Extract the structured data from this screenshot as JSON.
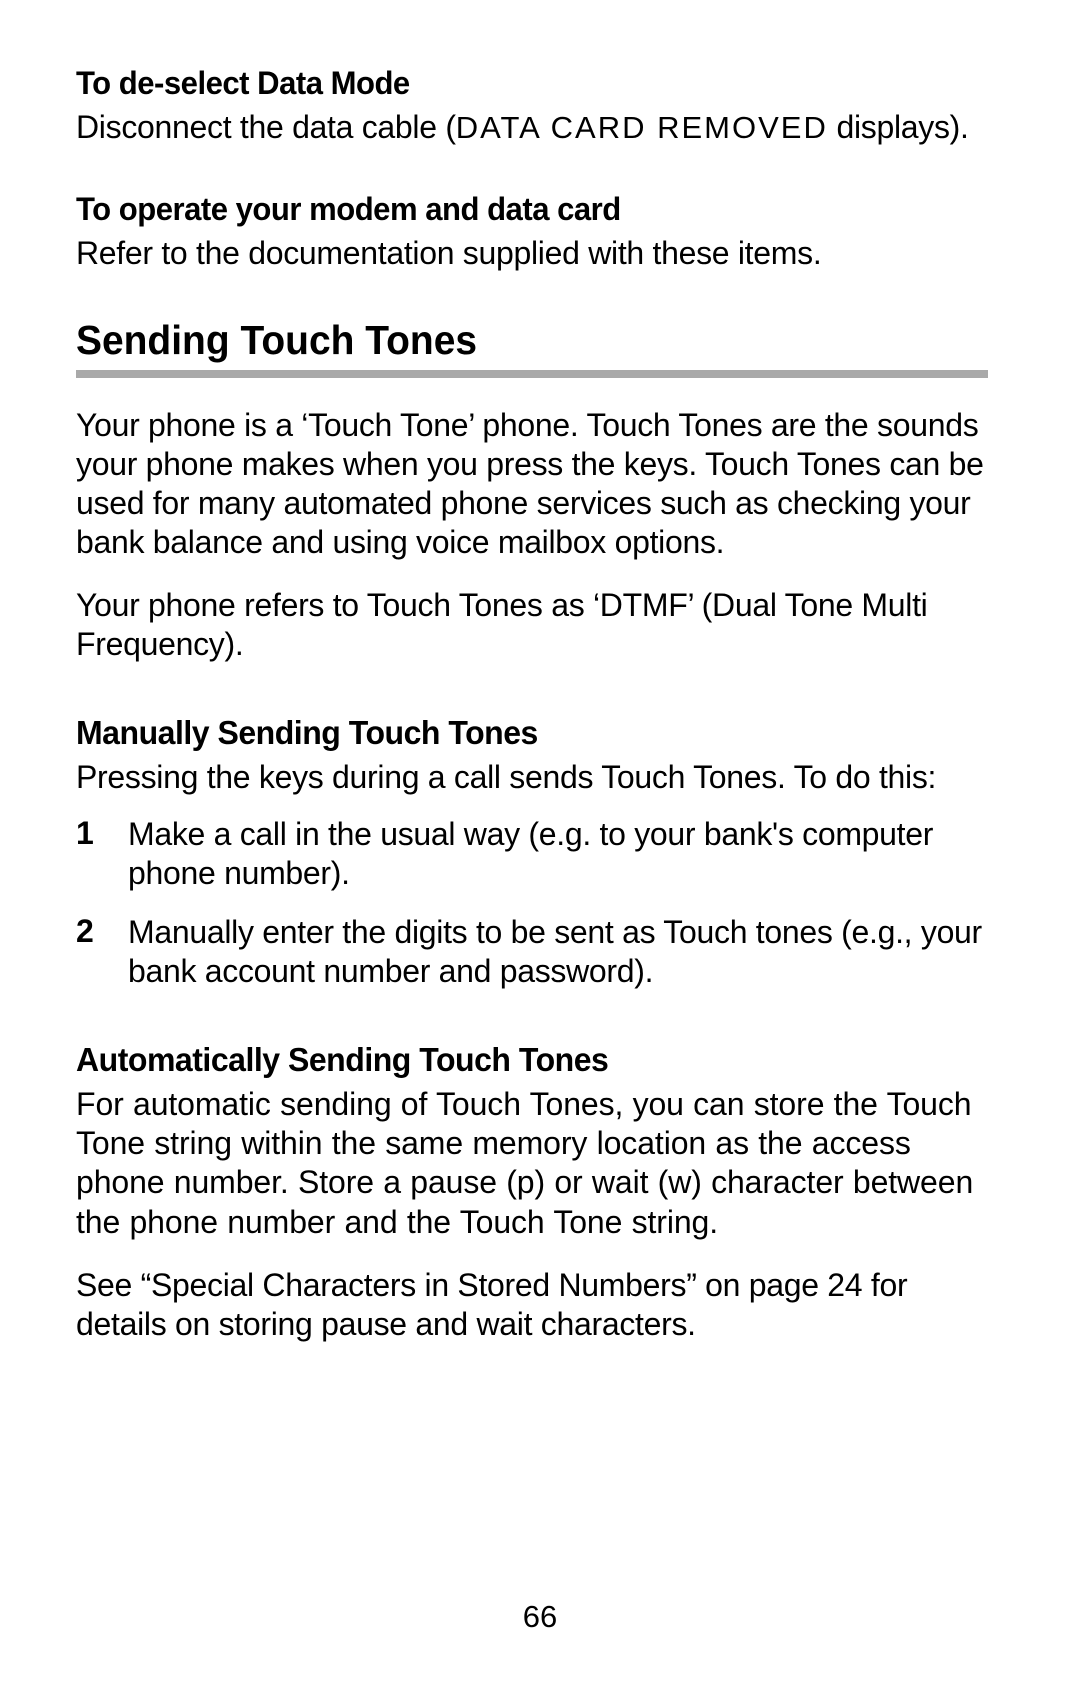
{
  "section1": {
    "heading": "To de-select Data Mode",
    "body_pre": "Disconnect the data cable (",
    "display": "DATA CARD REMOVED",
    "body_post": " displays)."
  },
  "section2": {
    "heading": "To operate your modem and data card",
    "body": "Refer to the documentation supplied with these items."
  },
  "main_heading": "Sending Touch Tones",
  "intro1": "Your phone is a ‘Touch Tone’ phone. Touch Tones are the sounds your phone makes when you press the keys. Touch Tones can be used for many automated phone services such as checking your bank balance and using voice mailbox options.",
  "intro2": "Your phone refers to Touch Tones as ‘DTMF’ (Dual Tone Multi Frequency).",
  "manual": {
    "heading": "Manually Sending Touch Tones",
    "body": "Pressing the keys during a call sends Touch Tones. To do this:",
    "steps": [
      "Make a call in the usual way (e.g. to your bank's computer phone number).",
      "Manually enter the digits to be sent as Touch tones (e.g., your bank account number and password)."
    ]
  },
  "auto": {
    "heading": "Automatically Sending Touch Tones",
    "body1": "For automatic sending of Touch Tones, you can store the Touch Tone string within the same memory location as the access phone number. Store a pause (p) or wait (w) character between the phone number and the Touch Tone string.",
    "body2": "See “Special Characters in Stored Numbers” on page 24 for details on storing pause and wait characters."
  },
  "page_number": "66"
}
